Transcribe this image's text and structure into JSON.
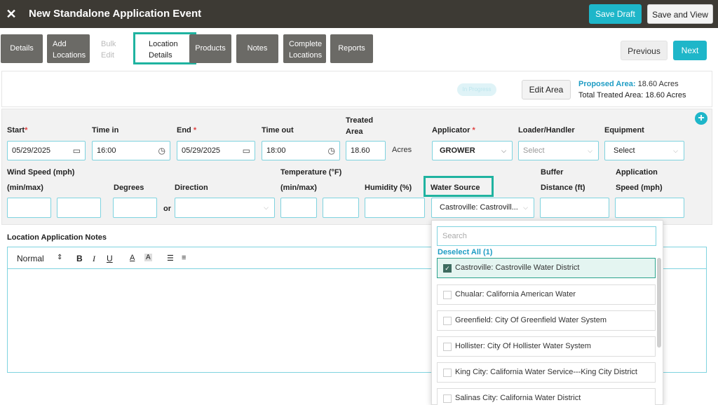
{
  "app": {
    "title": "New Standalone Application Event"
  },
  "header": {
    "save_draft": "Save Draft",
    "save_view": "Save and View"
  },
  "tabs": [
    {
      "label": "Details"
    },
    {
      "label": "Add\nLocations"
    },
    {
      "label": "Bulk\nEdit"
    },
    {
      "label": "Location\nDetails"
    },
    {
      "label": "Products"
    },
    {
      "label": "Notes"
    },
    {
      "label": "Complete\nLocations"
    },
    {
      "label": "Reports"
    }
  ],
  "nav": {
    "previous": "Previous",
    "next": "Next"
  },
  "info": {
    "status": "In Progress",
    "edit_area": "Edit Area",
    "proposed_label": "Proposed Area:",
    "proposed_value": "18.60 Acres",
    "total_label": "Total Treated Area:",
    "total_value": "18.60 Acres"
  },
  "form": {
    "start": {
      "label": "Start",
      "value": "05/29/2025"
    },
    "time_in": {
      "label": "Time in",
      "value": "16:00"
    },
    "end": {
      "label": "End",
      "value": "05/29/2025"
    },
    "time_out": {
      "label": "Time out",
      "value": "18:00"
    },
    "treated_area": {
      "label": "Treated\nArea",
      "value": "18.60",
      "unit": "Acres"
    },
    "applicator": {
      "label": "Applicator",
      "value": "GROWER"
    },
    "loader": {
      "label": "Loader/Handler",
      "placeholder": "Select"
    },
    "equipment": {
      "label": "Equipment",
      "value": "Select"
    },
    "wind_speed": {
      "label": "Wind Speed (mph)",
      "sub": "(min/max)"
    },
    "degrees": {
      "label": "Degrees",
      "or": "or"
    },
    "direction": {
      "label": "Direction"
    },
    "temperature": {
      "label": "Temperature (°F)",
      "sub": "(min/max)"
    },
    "humidity": {
      "label": "Humidity (%)"
    },
    "water_source": {
      "label": "Water Source",
      "value": "Castroville: Castrovill..."
    },
    "buffer": {
      "label": "Buffer",
      "sub": "Distance (ft)"
    },
    "app_speed": {
      "label": "Application",
      "sub": "Speed (mph)"
    }
  },
  "notes": {
    "label": "Location Application Notes",
    "format": "Normal",
    "bold": "B",
    "italic": "I",
    "underline": "U",
    "font_color": "A",
    "highlight": "A"
  },
  "dropdown": {
    "search_placeholder": "Search",
    "deselect_all": "Deselect All (1)",
    "options": [
      {
        "label": "Castroville: Castroville Water District",
        "selected": true
      },
      {
        "label": "Chualar: California American Water",
        "selected": false
      },
      {
        "label": "Greenfield: City Of Greenfield Water System",
        "selected": false
      },
      {
        "label": "Hollister: City Of Hollister Water System",
        "selected": false
      },
      {
        "label": "King City: California Water Service---King City District",
        "selected": false
      },
      {
        "label": "Salinas City: California Water District",
        "selected": false
      }
    ]
  },
  "colors": {
    "accent": "#1eb6c9",
    "highlight": "#1fb3a0",
    "topbar": "#3d3a34",
    "tab": "#6b6a66"
  }
}
